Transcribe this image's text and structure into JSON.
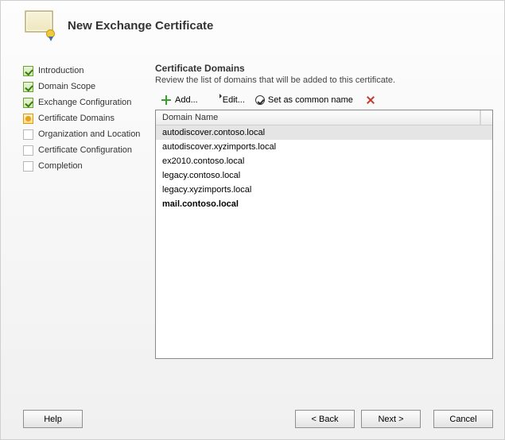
{
  "header": {
    "title": "New Exchange Certificate"
  },
  "nav": {
    "items": [
      {
        "label": "Introduction",
        "state": "done"
      },
      {
        "label": "Domain Scope",
        "state": "done"
      },
      {
        "label": "Exchange Configuration",
        "state": "done"
      },
      {
        "label": "Certificate Domains",
        "state": "active"
      },
      {
        "label": "Organization and Location",
        "state": "pending"
      },
      {
        "label": "Certificate Configuration",
        "state": "pending"
      },
      {
        "label": "Completion",
        "state": "pending"
      }
    ]
  },
  "main": {
    "section_title": "Certificate Domains",
    "section_subtitle": "Review the list of domains that will be added to this certificate.",
    "toolbar": {
      "add": "Add...",
      "edit": "Edit...",
      "set_common": "Set as common name"
    },
    "list": {
      "header": "Domain Name",
      "rows": [
        {
          "text": "autodiscover.contoso.local",
          "selected": true,
          "bold": false
        },
        {
          "text": "autodiscover.xyzimports.local",
          "selected": false,
          "bold": false
        },
        {
          "text": "ex2010.contoso.local",
          "selected": false,
          "bold": false
        },
        {
          "text": "legacy.contoso.local",
          "selected": false,
          "bold": false
        },
        {
          "text": "legacy.xyzimports.local",
          "selected": false,
          "bold": false
        },
        {
          "text": "mail.contoso.local",
          "selected": false,
          "bold": true
        }
      ]
    }
  },
  "footer": {
    "help": "Help",
    "back": "< Back",
    "next": "Next >",
    "cancel": "Cancel"
  }
}
